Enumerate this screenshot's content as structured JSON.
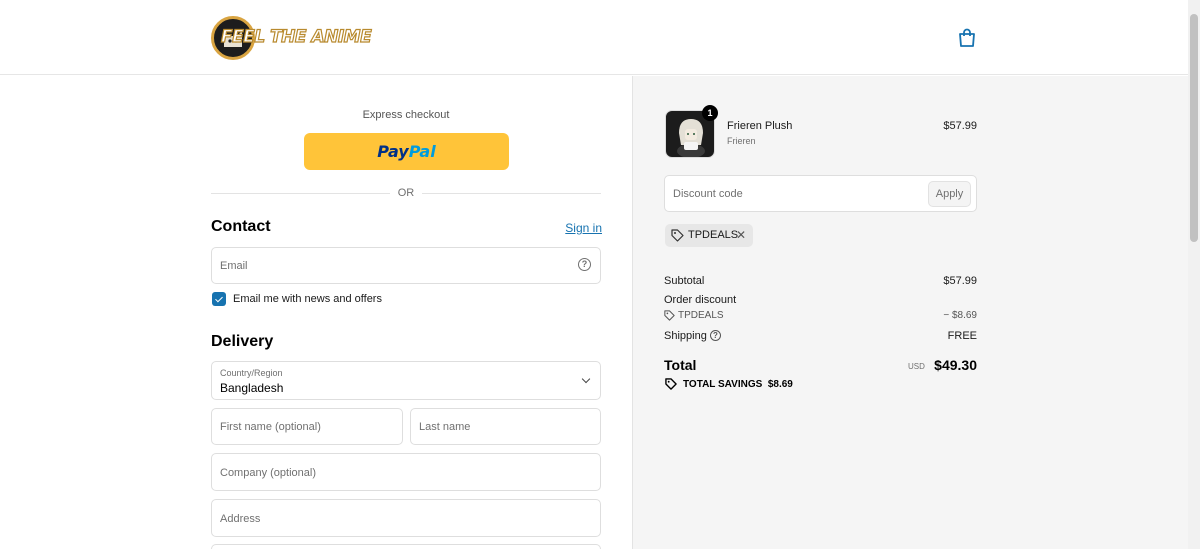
{
  "brand": {
    "name": "FEEL THE ANIME"
  },
  "express": {
    "label": "Express checkout",
    "paypal_part1": "Pay",
    "paypal_part2": "Pal",
    "or_label": "OR"
  },
  "contact": {
    "title": "Contact",
    "signin_label": "Sign in",
    "email_placeholder": "Email",
    "news_label": "Email me with news and offers",
    "news_checked": true
  },
  "delivery": {
    "title": "Delivery",
    "country_label": "Country/Region",
    "country_value": "Bangladesh",
    "first_name_placeholder": "First name (optional)",
    "last_name_placeholder": "Last name",
    "company_placeholder": "Company (optional)",
    "address_placeholder": "Address"
  },
  "cart": {
    "item": {
      "name": "Frieren Plush",
      "variant": "Frieren",
      "price": "$57.99",
      "quantity": "1"
    },
    "discount_placeholder": "Discount code",
    "apply_label": "Apply",
    "applied_code": "TPDEALS"
  },
  "summary": {
    "subtotal_label": "Subtotal",
    "subtotal_value": "$57.99",
    "order_discount_label": "Order discount",
    "discount_code": "TPDEALS",
    "discount_value": "− $8.69",
    "shipping_label": "Shipping",
    "shipping_value": "FREE",
    "total_label": "Total",
    "currency": "USD",
    "total_value": "$49.30",
    "savings_label": "TOTAL SAVINGS",
    "savings_value": "$8.69"
  },
  "colors": {
    "accent": "#1773b0",
    "paypal": "#ffc439",
    "panel": "#f5f5f5"
  },
  "icons": [
    "shopping-bag-icon",
    "question-icon",
    "chevron-down-icon",
    "checkmark-icon",
    "tag-icon",
    "close-icon"
  ]
}
